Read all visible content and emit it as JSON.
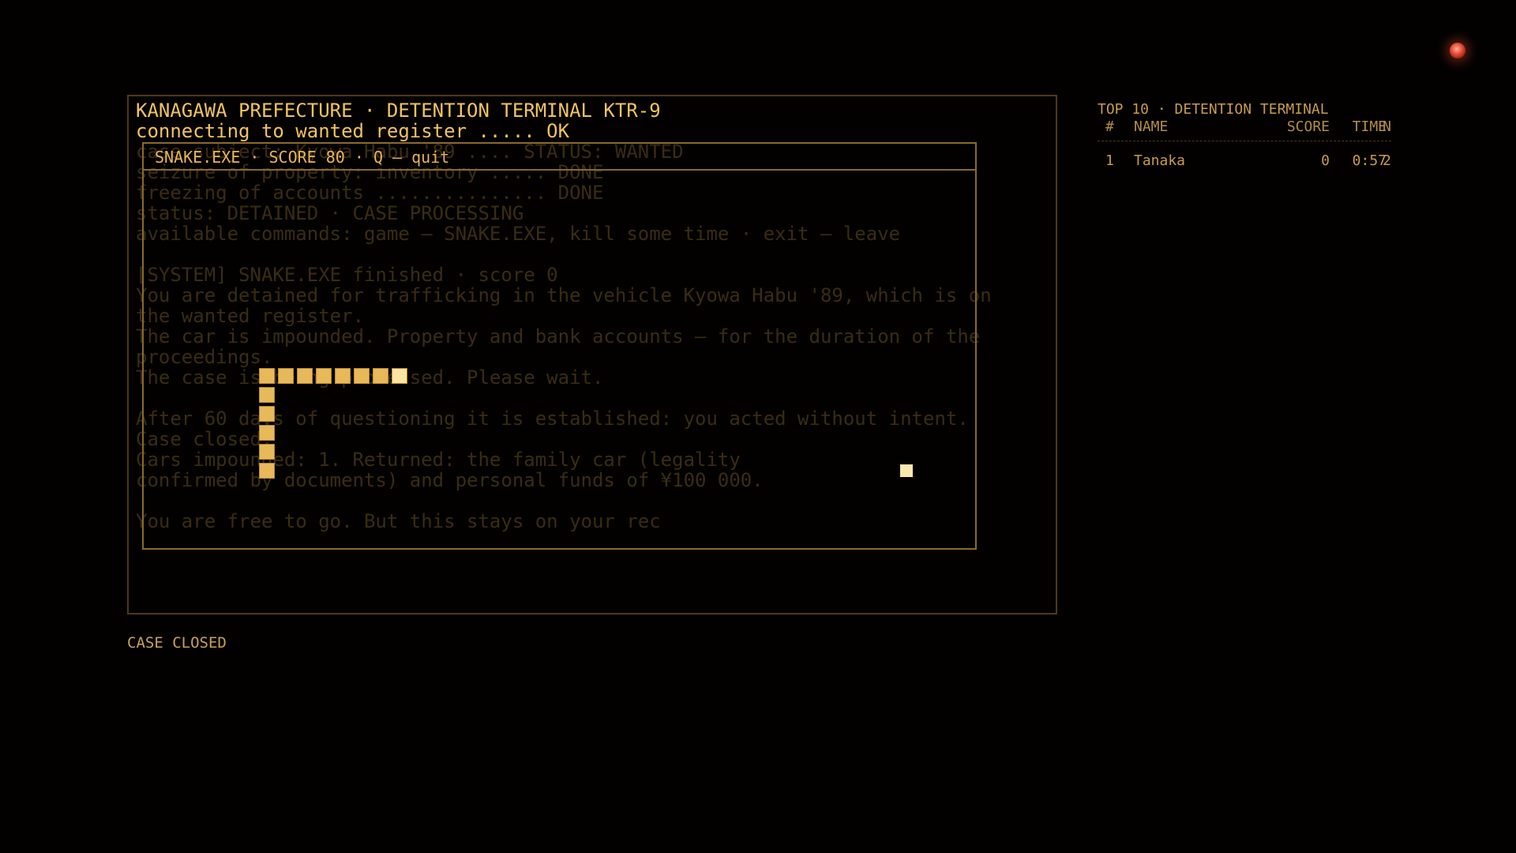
{
  "terminal": {
    "line1": "KANAGAWA PREFECTURE · DETENTION TERMINAL KTR-9",
    "line2": "connecting to wanted register ..... OK"
  },
  "background_log": [
    "case subject: Kyowa Habu '89 .... STATUS: WANTED",
    "seizure of property: inventory ..... DONE",
    "freezing of accounts ............... DONE",
    "status: DETAINED · CASE PROCESSING",
    "available commands: game — SNAKE.EXE, kill some time · exit — leave",
    "",
    "[SYSTEM] SNAKE.EXE finished · score 0",
    "You are detained for trafficking in the vehicle Kyowa Habu '89, which is on",
    "the wanted register.",
    "The car is impounded. Property and bank accounts — for the duration of the",
    "proceedings.",
    "The case is being processed. Please wait.",
    "",
    "After 60 days of questioning it is established: you acted without intent.",
    "Case closed.",
    "Cars impounded: 1. Returned: the family car (legality",
    "confirmed by documents) and personal funds of ¥100 000.",
    "",
    "You are free to go. But this stays on your rec"
  ],
  "snake_window": {
    "title": "SNAKE.EXE · SCORE 80 · Q — quit",
    "score": 80,
    "grid_cell": "24",
    "snake_cells": [
      [
        7,
        4
      ],
      [
        6,
        4
      ],
      [
        5,
        4
      ],
      [
        4,
        4
      ],
      [
        3,
        4
      ],
      [
        2,
        4
      ],
      [
        1,
        4
      ],
      [
        0,
        4
      ],
      [
        0,
        5
      ],
      [
        0,
        6
      ],
      [
        0,
        7
      ],
      [
        0,
        8
      ],
      [
        0,
        9
      ]
    ],
    "food_cell": [
      34,
      9
    ]
  },
  "status_footer": "CASE CLOSED",
  "leaderboard": {
    "title": "TOP 10 · DETENTION TERMINAL",
    "headers": {
      "rank": "#",
      "name": "NAME",
      "score": "SCORE",
      "time": "TIME",
      "n": "N"
    },
    "rows": [
      {
        "rank": "1",
        "name": "Tanaka",
        "score": "0",
        "time": "0:57",
        "n": "2"
      }
    ]
  },
  "colors": {
    "amber": "#e8b34e",
    "dim_text": "#3a2c12",
    "frame": "#4e3a17",
    "snake": "#e7b95a",
    "led": "#e6503a"
  },
  "icons": {
    "led": "red-status-led"
  }
}
